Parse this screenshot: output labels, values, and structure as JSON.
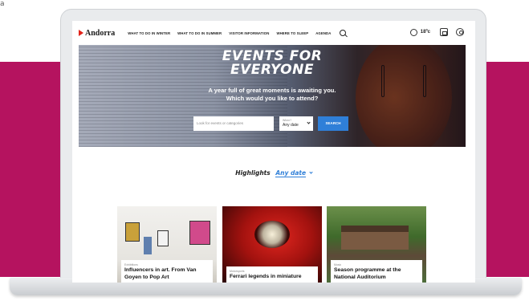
{
  "corner_mark": "a",
  "nav": {
    "logo": "Andorra",
    "items": [
      "WHAT TO DO IN WINTER",
      "WHAT TO DO IN SUMMER",
      "VISITOR INFORMATION",
      "WHERE TO SLEEP",
      "AGENDA"
    ],
    "temperature": "18ºc"
  },
  "hero": {
    "title_line1": "EVENTS FOR",
    "title_line2": "EVERYONE",
    "subtitle_line1": "A year full of great moments is awaiting you.",
    "subtitle_line2": "Which would you like to attend?",
    "search_placeholder": "Look for events or categories",
    "date_label": "When?",
    "date_value": "Any date",
    "search_button": "SEARCH"
  },
  "highlights": {
    "label": "Highlights",
    "date_filter": "Any date"
  },
  "cards": [
    {
      "category": "Exhibitions",
      "title_line1": "Influencers in art. From Van",
      "title_line2": "Goyen to Pop Art"
    },
    {
      "category": "Motorsports",
      "title_line1": "Ferrari legends in miniature",
      "title_line2": ""
    },
    {
      "category": "Music",
      "title_line1": "Season programme at the",
      "title_line2": "National Auditorium"
    }
  ],
  "colors": {
    "band": "#b5135f",
    "accent_blue": "#2f7fd8",
    "logo_red": "#e2231a"
  }
}
